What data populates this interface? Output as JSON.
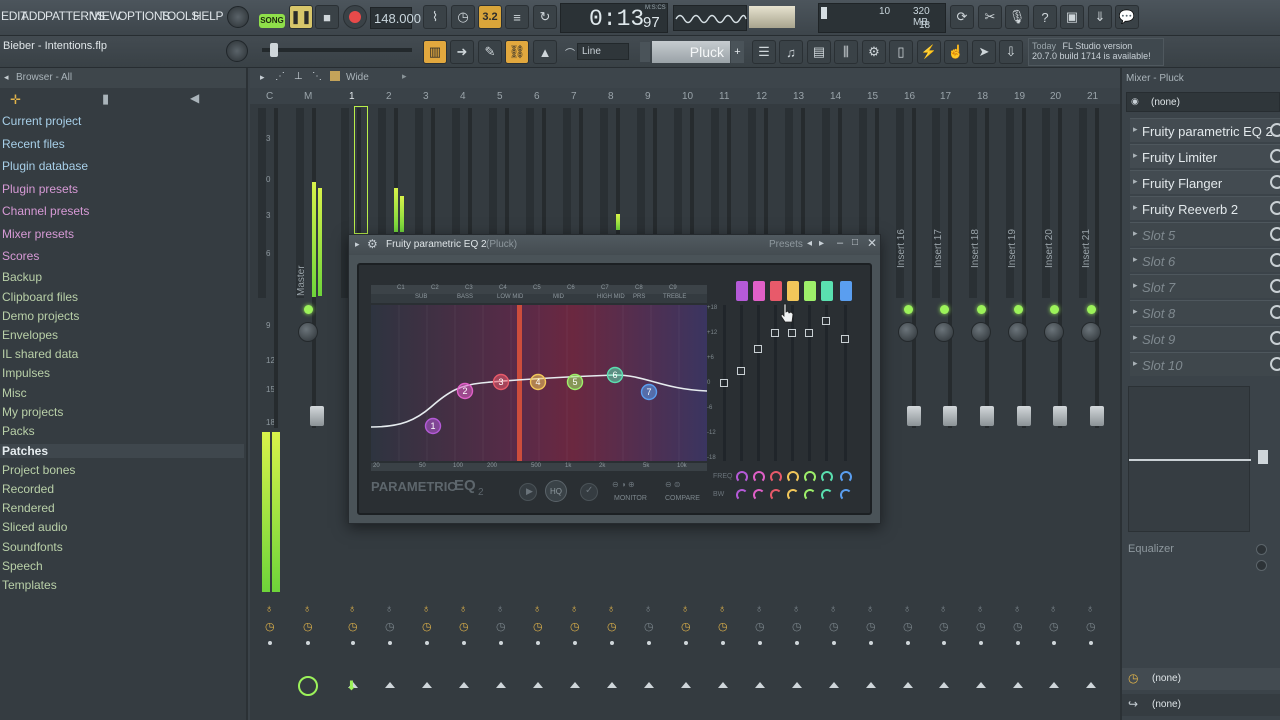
{
  "menu": [
    "EDIT",
    "ADD",
    "PATTERNS",
    "VIEW",
    "OPTIONS",
    "TOOLS",
    "HELP"
  ],
  "transport": {
    "mode_label": "SONG",
    "tempo": "148.000",
    "time": "0:13",
    "time_frac": "97",
    "time_unit": "M:S:CS",
    "step_value": "3.2",
    "memory": "320 MB",
    "cpu_top": "10",
    "polyphony": "18"
  },
  "project_file": "Bieber - Intentions.flp",
  "snap_mode": "Line",
  "pattern_name": "Pluck",
  "news": {
    "label": "Today",
    "line1": "FL Studio version",
    "line2": "20.7.0 build 1714 is available!"
  },
  "browser": {
    "title": "Browser - All",
    "items": [
      {
        "label": "Current project",
        "kind": "cyan"
      },
      {
        "label": "Recent files",
        "kind": "cyan"
      },
      {
        "label": "Plugin database",
        "kind": "cyan"
      },
      {
        "label": "Plugin presets",
        "kind": "pink"
      },
      {
        "label": "Channel presets",
        "kind": "pink"
      },
      {
        "label": "Mixer presets",
        "kind": "pink"
      },
      {
        "label": "Scores",
        "kind": "pink"
      },
      {
        "label": "Backup",
        "kind": "green"
      },
      {
        "label": "Clipboard files",
        "kind": "green"
      },
      {
        "label": "Demo projects",
        "kind": "green"
      },
      {
        "label": "Envelopes",
        "kind": "green"
      },
      {
        "label": "IL shared data",
        "kind": "green"
      },
      {
        "label": "Impulses",
        "kind": "green"
      },
      {
        "label": "Misc",
        "kind": "green"
      },
      {
        "label": "My projects",
        "kind": "green"
      },
      {
        "label": "Packs",
        "kind": "green"
      },
      {
        "label": "Patches",
        "kind": "selected"
      },
      {
        "label": "Project bones",
        "kind": "green"
      },
      {
        "label": "Recorded",
        "kind": "green"
      },
      {
        "label": "Rendered",
        "kind": "green"
      },
      {
        "label": "Sliced audio",
        "kind": "green"
      },
      {
        "label": "Soundfonts",
        "kind": "green"
      },
      {
        "label": "Speech",
        "kind": "green"
      },
      {
        "label": "Templates",
        "kind": "green"
      }
    ]
  },
  "mixer": {
    "view_label": "Wide",
    "track_numbers": [
      "C",
      "M",
      "1",
      "2",
      "3",
      "4",
      "5",
      "6",
      "7",
      "8",
      "9",
      "10",
      "11",
      "12",
      "13",
      "14",
      "15",
      "16",
      "17",
      "18",
      "19",
      "20",
      "21"
    ],
    "master_label": "Master",
    "meter_scale": [
      "3",
      "0",
      "3",
      "6",
      "9",
      "12",
      "15",
      "18",
      "21"
    ],
    "insert_labels": [
      "Insert 16",
      "Insert 17",
      "Insert 18",
      "Insert 19",
      "Insert 20",
      "Insert 21"
    ]
  },
  "mixer_panel": {
    "title": "Mixer - Pluck",
    "input": "(none)",
    "slots": [
      {
        "label": "Fruity parametric EQ 2",
        "active": true
      },
      {
        "label": "Fruity Limiter",
        "active": true
      },
      {
        "label": "Fruity Flanger",
        "active": true
      },
      {
        "label": "Fruity Reeverb 2",
        "active": true
      },
      {
        "label": "Slot 5",
        "active": false
      },
      {
        "label": "Slot 6",
        "active": false
      },
      {
        "label": "Slot 7",
        "active": false
      },
      {
        "label": "Slot 8",
        "active": false
      },
      {
        "label": "Slot 9",
        "active": false
      },
      {
        "label": "Slot 10",
        "active": false
      }
    ],
    "eq_label": "Equalizer",
    "output_top": "(none)",
    "output_bottom": "(none)"
  },
  "eq": {
    "title": "Fruity parametric EQ 2",
    "channel": "(Pluck)",
    "presets_label": "Presets",
    "notes": [
      "C1",
      "C2",
      "C3",
      "C4",
      "C5",
      "C6",
      "C7",
      "C8",
      "C9"
    ],
    "bands_labels": [
      "SUB",
      "BASS",
      "LOW MID",
      "MID",
      "HIGH MID",
      "PRS",
      "TREBLE"
    ],
    "freq_labels": [
      "20",
      "50",
      "100",
      "200",
      "500",
      "1k",
      "2k",
      "5k",
      "10k"
    ],
    "db_labels": [
      "+18",
      "+12",
      "+6",
      "0",
      "-6",
      "-12",
      "-18"
    ],
    "band_nodes": [
      "1",
      "2",
      "3",
      "4",
      "5",
      "6",
      "7"
    ],
    "band_colors": [
      "#b55ad8",
      "#e060c8",
      "#e85a6a",
      "#f2c75a",
      "#9ef06a",
      "#5ae0b0",
      "#5a9ef0"
    ],
    "band_levels": [
      0.58,
      0.72,
      0.82,
      0.82,
      0.82,
      0.9,
      0.78
    ],
    "logo_text": "PARAMETRIC",
    "logo_eq": "EQ",
    "logo_num": "2",
    "freq_row": "FREQ",
    "bw_row": "BW",
    "hq_label": "HQ",
    "monitor_label": "MONITOR",
    "compare_label": "COMPARE"
  }
}
